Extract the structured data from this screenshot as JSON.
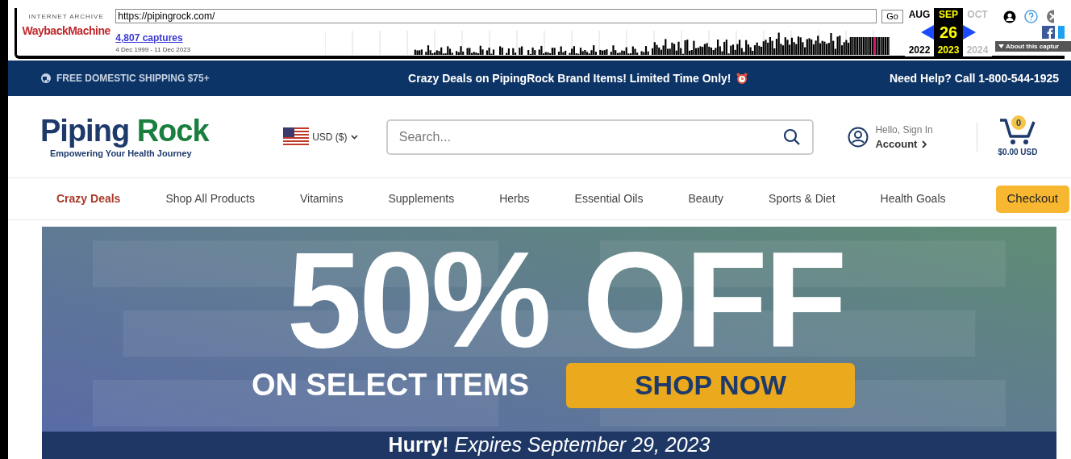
{
  "wayback": {
    "brand_top": "INTERNET ARCHIVE",
    "brand": "WaybackMachine",
    "url": "https://pipingrock.com/",
    "go": "Go",
    "captures": "4,807 captures",
    "range": "4 Dec 1999 - 11 Dec 2023",
    "months": [
      {
        "label": "AUG",
        "year": "2022",
        "selected": false,
        "disabled": false
      },
      {
        "label": "SEP",
        "day": "26",
        "year": "2023",
        "selected": true,
        "disabled": false
      },
      {
        "label": "OCT",
        "year": "2024",
        "selected": false,
        "disabled": true
      }
    ],
    "about": "About this captur"
  },
  "promo_bar": {
    "shipping": "FREE DOMESTIC SHIPPING $75+",
    "center": "Crazy Deals on PipingRock Brand Items! Limited Time Only!",
    "help": "Need Help? Call 1-800-544-1925"
  },
  "header": {
    "logo_first": "Piping",
    "logo_second": "Rock",
    "tagline": "Empowering Your Health Journey",
    "currency": "USD ($)",
    "search_placeholder": "Search...",
    "greeting": "Hello, Sign In",
    "account": "Account",
    "cart_count": "0",
    "cart_total": "$0.00 USD"
  },
  "nav": [
    {
      "label": "Crazy Deals",
      "kind": "highlight"
    },
    {
      "label": "Shop All Products",
      "kind": "link"
    },
    {
      "label": "Vitamins",
      "kind": "link"
    },
    {
      "label": "Supplements",
      "kind": "link"
    },
    {
      "label": "Herbs",
      "kind": "link"
    },
    {
      "label": "Essential Oils",
      "kind": "link"
    },
    {
      "label": "Beauty",
      "kind": "link"
    },
    {
      "label": "Sports & Diet",
      "kind": "link"
    },
    {
      "label": "Health Goals",
      "kind": "link"
    },
    {
      "label": "Checkout",
      "kind": "button"
    }
  ],
  "banner": {
    "headline": "50% OFF",
    "subline": "ON SELECT ITEMS",
    "cta": "SHOP NOW",
    "footer": "**Hurry!** *Expires  September 29, 2023*"
  }
}
